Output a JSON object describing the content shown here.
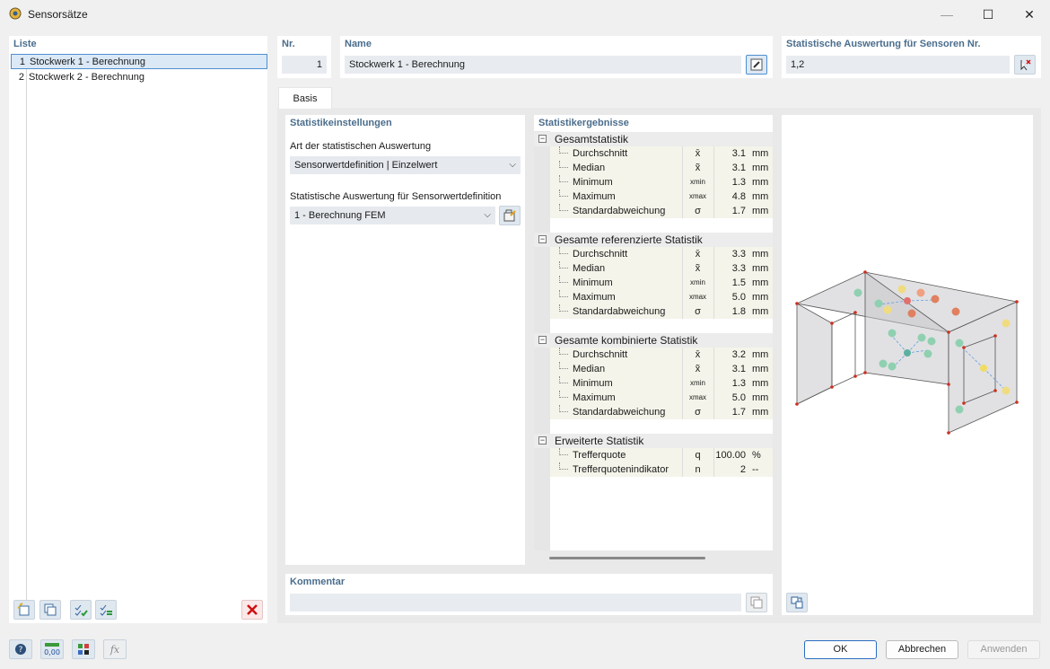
{
  "window": {
    "title": "Sensorsätze",
    "minimize": "—",
    "maximize": "☐",
    "close": "✕"
  },
  "list": {
    "header": "Liste",
    "items": [
      {
        "num": "1",
        "label": "Stockwerk 1 - Berechnung"
      },
      {
        "num": "2",
        "label": "Stockwerk 2 - Berechnung"
      }
    ]
  },
  "top": {
    "nr_label": "Nr.",
    "nr_value": "1",
    "name_label": "Name",
    "name_value": "Stockwerk 1 - Berechnung",
    "stat_label": "Statistische Auswertung für Sensoren Nr.",
    "stat_value": "1,2"
  },
  "tabs": [
    {
      "label": "Basis"
    }
  ],
  "settings": {
    "header": "Statistikeinstellungen",
    "type_label": "Art der statistischen Auswertung",
    "type_value": "Sensorwertdefinition | Einzelwert",
    "def_label": "Statistische Auswertung für Sensorwertdefinition",
    "def_value": "1 - Berechnung FEM"
  },
  "results": {
    "header": "Statistikergebnisse",
    "groups": [
      {
        "label": "Gesamtstatistik",
        "toggle": "−",
        "rows": [
          {
            "name": "Durchschnitt",
            "sym": "x̄",
            "val": "3.1",
            "unit": "mm"
          },
          {
            "name": "Median",
            "sym": "x̃",
            "val": "3.1",
            "unit": "mm"
          },
          {
            "name": "Minimum",
            "sym": "xmin",
            "val": "1.3",
            "unit": "mm"
          },
          {
            "name": "Maximum",
            "sym": "xmax",
            "val": "4.8",
            "unit": "mm"
          },
          {
            "name": "Standardabweichung",
            "sym": "σ",
            "val": "1.7",
            "unit": "mm"
          }
        ]
      },
      {
        "label": "Gesamte referenzierte Statistik",
        "toggle": "−",
        "rows": [
          {
            "name": "Durchschnitt",
            "sym": "x̄",
            "val": "3.3",
            "unit": "mm"
          },
          {
            "name": "Median",
            "sym": "x̃",
            "val": "3.3",
            "unit": "mm"
          },
          {
            "name": "Minimum",
            "sym": "xmin",
            "val": "1.5",
            "unit": "mm"
          },
          {
            "name": "Maximum",
            "sym": "xmax",
            "val": "5.0",
            "unit": "mm"
          },
          {
            "name": "Standardabweichung",
            "sym": "σ",
            "val": "1.8",
            "unit": "mm"
          }
        ]
      },
      {
        "label": "Gesamte kombinierte Statistik",
        "toggle": "−",
        "rows": [
          {
            "name": "Durchschnitt",
            "sym": "x̄",
            "val": "3.2",
            "unit": "mm"
          },
          {
            "name": "Median",
            "sym": "x̃",
            "val": "3.1",
            "unit": "mm"
          },
          {
            "name": "Minimum",
            "sym": "xmin",
            "val": "1.3",
            "unit": "mm"
          },
          {
            "name": "Maximum",
            "sym": "xmax",
            "val": "5.0",
            "unit": "mm"
          },
          {
            "name": "Standardabweichung",
            "sym": "σ",
            "val": "1.7",
            "unit": "mm"
          }
        ]
      },
      {
        "label": "Erweiterte Statistik",
        "toggle": "−",
        "rows": [
          {
            "name": "Trefferquote",
            "sym": "q",
            "val": "100.00",
            "unit": "%"
          },
          {
            "name": "Trefferquotenindikator",
            "sym": "n",
            "val": "2",
            "unit": "--"
          }
        ]
      }
    ]
  },
  "comment": {
    "label": "Kommentar",
    "value": ""
  },
  "footer": {
    "ok": "OK",
    "cancel": "Abbrechen",
    "apply": "Anwenden"
  },
  "colors": {
    "accent": "#4a6d8c",
    "selection": "#dbe9f7",
    "delete": "#d01010"
  }
}
